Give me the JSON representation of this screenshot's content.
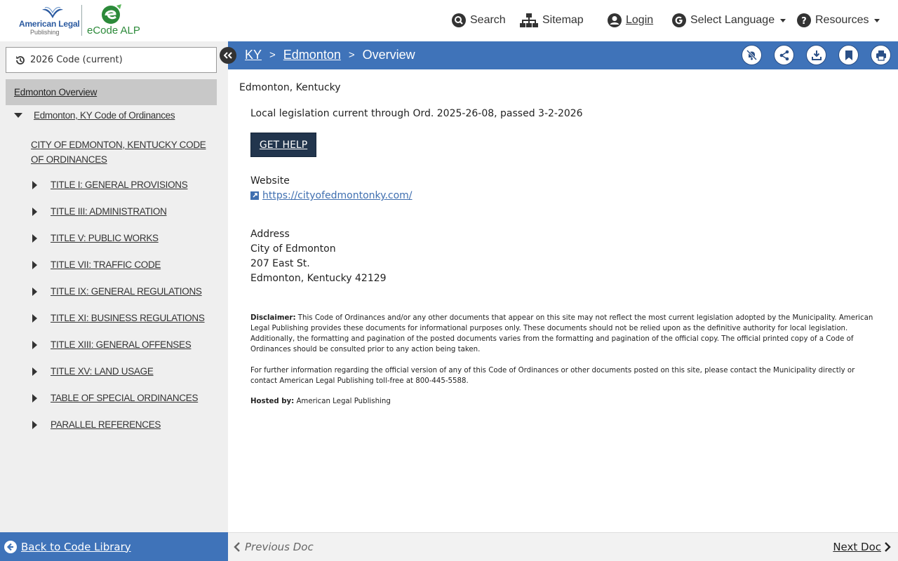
{
  "header": {
    "logo_publisher_line1": "American Legal",
    "logo_publisher_line2": "Publishing",
    "logo_product": "eCode ALP",
    "nav": {
      "search": "Search",
      "sitemap": "Sitemap",
      "login": "Login",
      "language": "Select Language",
      "resources": "Resources"
    },
    "icons": [
      "search-icon",
      "sitemap-icon",
      "user-icon",
      "google-g-icon",
      "question-icon",
      "chevron-down-icon"
    ]
  },
  "sidebar": {
    "version": "2026 Code (current)",
    "overview": "Edmonton Overview",
    "root": "Edmonton, KY Code of Ordinances",
    "heading": "CITY OF EDMONTON, KENTUCKY CODE OF ORDINANCES",
    "items": [
      {
        "label": "TITLE I: GENERAL PROVISIONS"
      },
      {
        "label": "TITLE III: ADMINISTRATION"
      },
      {
        "label": "TITLE V: PUBLIC WORKS"
      },
      {
        "label": "TITLE VII: TRAFFIC CODE"
      },
      {
        "label": "TITLE IX: GENERAL REGULATIONS"
      },
      {
        "label": "TITLE XI: BUSINESS REGULATIONS"
      },
      {
        "label": "TITLE XIII: GENERAL OFFENSES"
      },
      {
        "label": "TITLE XV: LAND USAGE"
      },
      {
        "label": "TABLE OF SPECIAL ORDINANCES"
      },
      {
        "label": "PARALLEL REFERENCES"
      }
    ],
    "back": "Back to Code Library"
  },
  "breadcrumb": {
    "state": "KY",
    "city": "Edmonton",
    "sep": ">",
    "current": "Overview"
  },
  "toolbar_icons": [
    "notifications-off-icon",
    "share-icon",
    "download-icon",
    "bookmark-icon",
    "print-icon"
  ],
  "main": {
    "city_title": "Edmonton, Kentucky",
    "current_through": "Local legislation current through Ord. 2025-26-08, passed 3-2-2026",
    "help_button": "GET HELP",
    "website_label": "Website",
    "website_url": "https://cityofedmontonky.com/",
    "address_label": "Address",
    "address_line1": "City of Edmonton",
    "address_line2": "207 East St.",
    "address_line3": "Edmonton, Kentucky 42129",
    "disclaimer_label": "Disclaimer:",
    "disclaimer_text": " This Code of Ordinances and/or any other documents that appear on this site may not reflect the most current legislation adopted by the Municipality. American Legal Publishing provides these documents for informational purposes only. These documents should not be relied upon as the definitive authority for local legislation. Additionally, the formatting and pagination of the posted documents varies from the formatting and pagination of the official copy. The official printed copy of a Code of Ordinances should be consulted prior to any action being taken.",
    "further_info": "For further information regarding the official version of any of this Code of Ordinances or other documents posted on this site, please contact the Municipality directly or contact American Legal Publishing toll-free at 800-445-5588.",
    "hosted_label": "Hosted by:",
    "hosted_value": " American Legal Publishing"
  },
  "footer": {
    "prev": "Previous Doc",
    "next": "Next Doc"
  },
  "colors": {
    "accent_blue": "#3f73b9",
    "help_button_bg": "#22354d",
    "sidebar_bg": "#efefef",
    "link_blue": "#3f6fb0",
    "brand_green": "#2c8a3a"
  }
}
